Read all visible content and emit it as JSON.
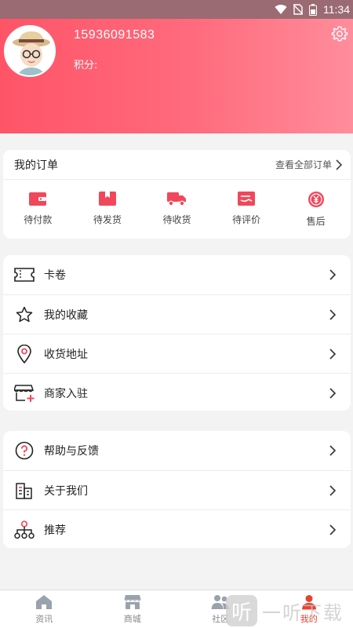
{
  "status_bar": {
    "time": "11:34"
  },
  "profile": {
    "phone": "15936091583",
    "points_label": "积分:"
  },
  "orders": {
    "title": "我的订单",
    "view_all": "查看全部订单",
    "items": [
      {
        "label": "待付款",
        "icon": "wallet-icon"
      },
      {
        "label": "待发货",
        "icon": "package-icon"
      },
      {
        "label": "待收货",
        "icon": "truck-icon"
      },
      {
        "label": "待评价",
        "icon": "review-icon"
      },
      {
        "label": "售后",
        "icon": "yen-coin-icon"
      }
    ]
  },
  "menu1": [
    {
      "label": "卡卷",
      "icon": "ticket-icon"
    },
    {
      "label": "我的收藏",
      "icon": "star-icon"
    },
    {
      "label": "收货地址",
      "icon": "location-pin-icon"
    },
    {
      "label": "商家入驻",
      "icon": "shop-add-icon"
    }
  ],
  "menu2": [
    {
      "label": "帮助与反馈",
      "icon": "help-icon"
    },
    {
      "label": "关于我们",
      "icon": "building-icon"
    },
    {
      "label": "推荐",
      "icon": "network-icon"
    }
  ],
  "nav": [
    {
      "label": "资讯",
      "icon": "home-icon"
    },
    {
      "label": "商城",
      "icon": "store-icon"
    },
    {
      "label": "社区",
      "icon": "community-icon"
    },
    {
      "label": "我的",
      "icon": "user-icon",
      "active": true
    }
  ],
  "watermark": {
    "text": "一听下载",
    "glyph": "听"
  },
  "colors": {
    "accent": "#ff5468",
    "icon_red": "#f2475a",
    "nav_active": "#e8412f"
  }
}
